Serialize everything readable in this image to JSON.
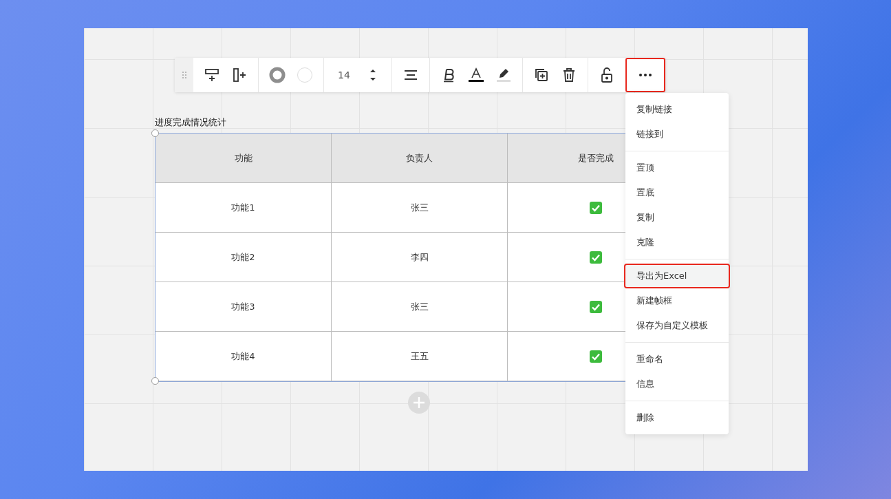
{
  "toolbar": {
    "font_size": "14",
    "more_highlighted": true
  },
  "table": {
    "title": "进度完成情况统计",
    "columns": [
      "功能",
      "负责人",
      "是否完成"
    ],
    "rows": [
      {
        "feature": "功能1",
        "owner": "张三",
        "done": true
      },
      {
        "feature": "功能2",
        "owner": "李四",
        "done": true
      },
      {
        "feature": "功能3",
        "owner": "张三",
        "done": true
      },
      {
        "feature": "功能4",
        "owner": "王五",
        "done": true
      }
    ]
  },
  "menu": {
    "groups": [
      [
        {
          "label": "复制链接",
          "highlighted": false
        },
        {
          "label": "链接到",
          "highlighted": false
        }
      ],
      [
        {
          "label": "置顶",
          "highlighted": false
        },
        {
          "label": "置底",
          "highlighted": false
        },
        {
          "label": "复制",
          "highlighted": false
        },
        {
          "label": "克隆",
          "highlighted": false
        }
      ],
      [
        {
          "label": "导出为Excel",
          "highlighted": true
        },
        {
          "label": "新建帧框",
          "highlighted": false
        },
        {
          "label": "保存为自定义模板",
          "highlighted": false
        }
      ],
      [
        {
          "label": "重命名",
          "highlighted": false
        },
        {
          "label": "信息",
          "highlighted": false
        }
      ],
      [
        {
          "label": "删除",
          "highlighted": false
        }
      ]
    ]
  }
}
